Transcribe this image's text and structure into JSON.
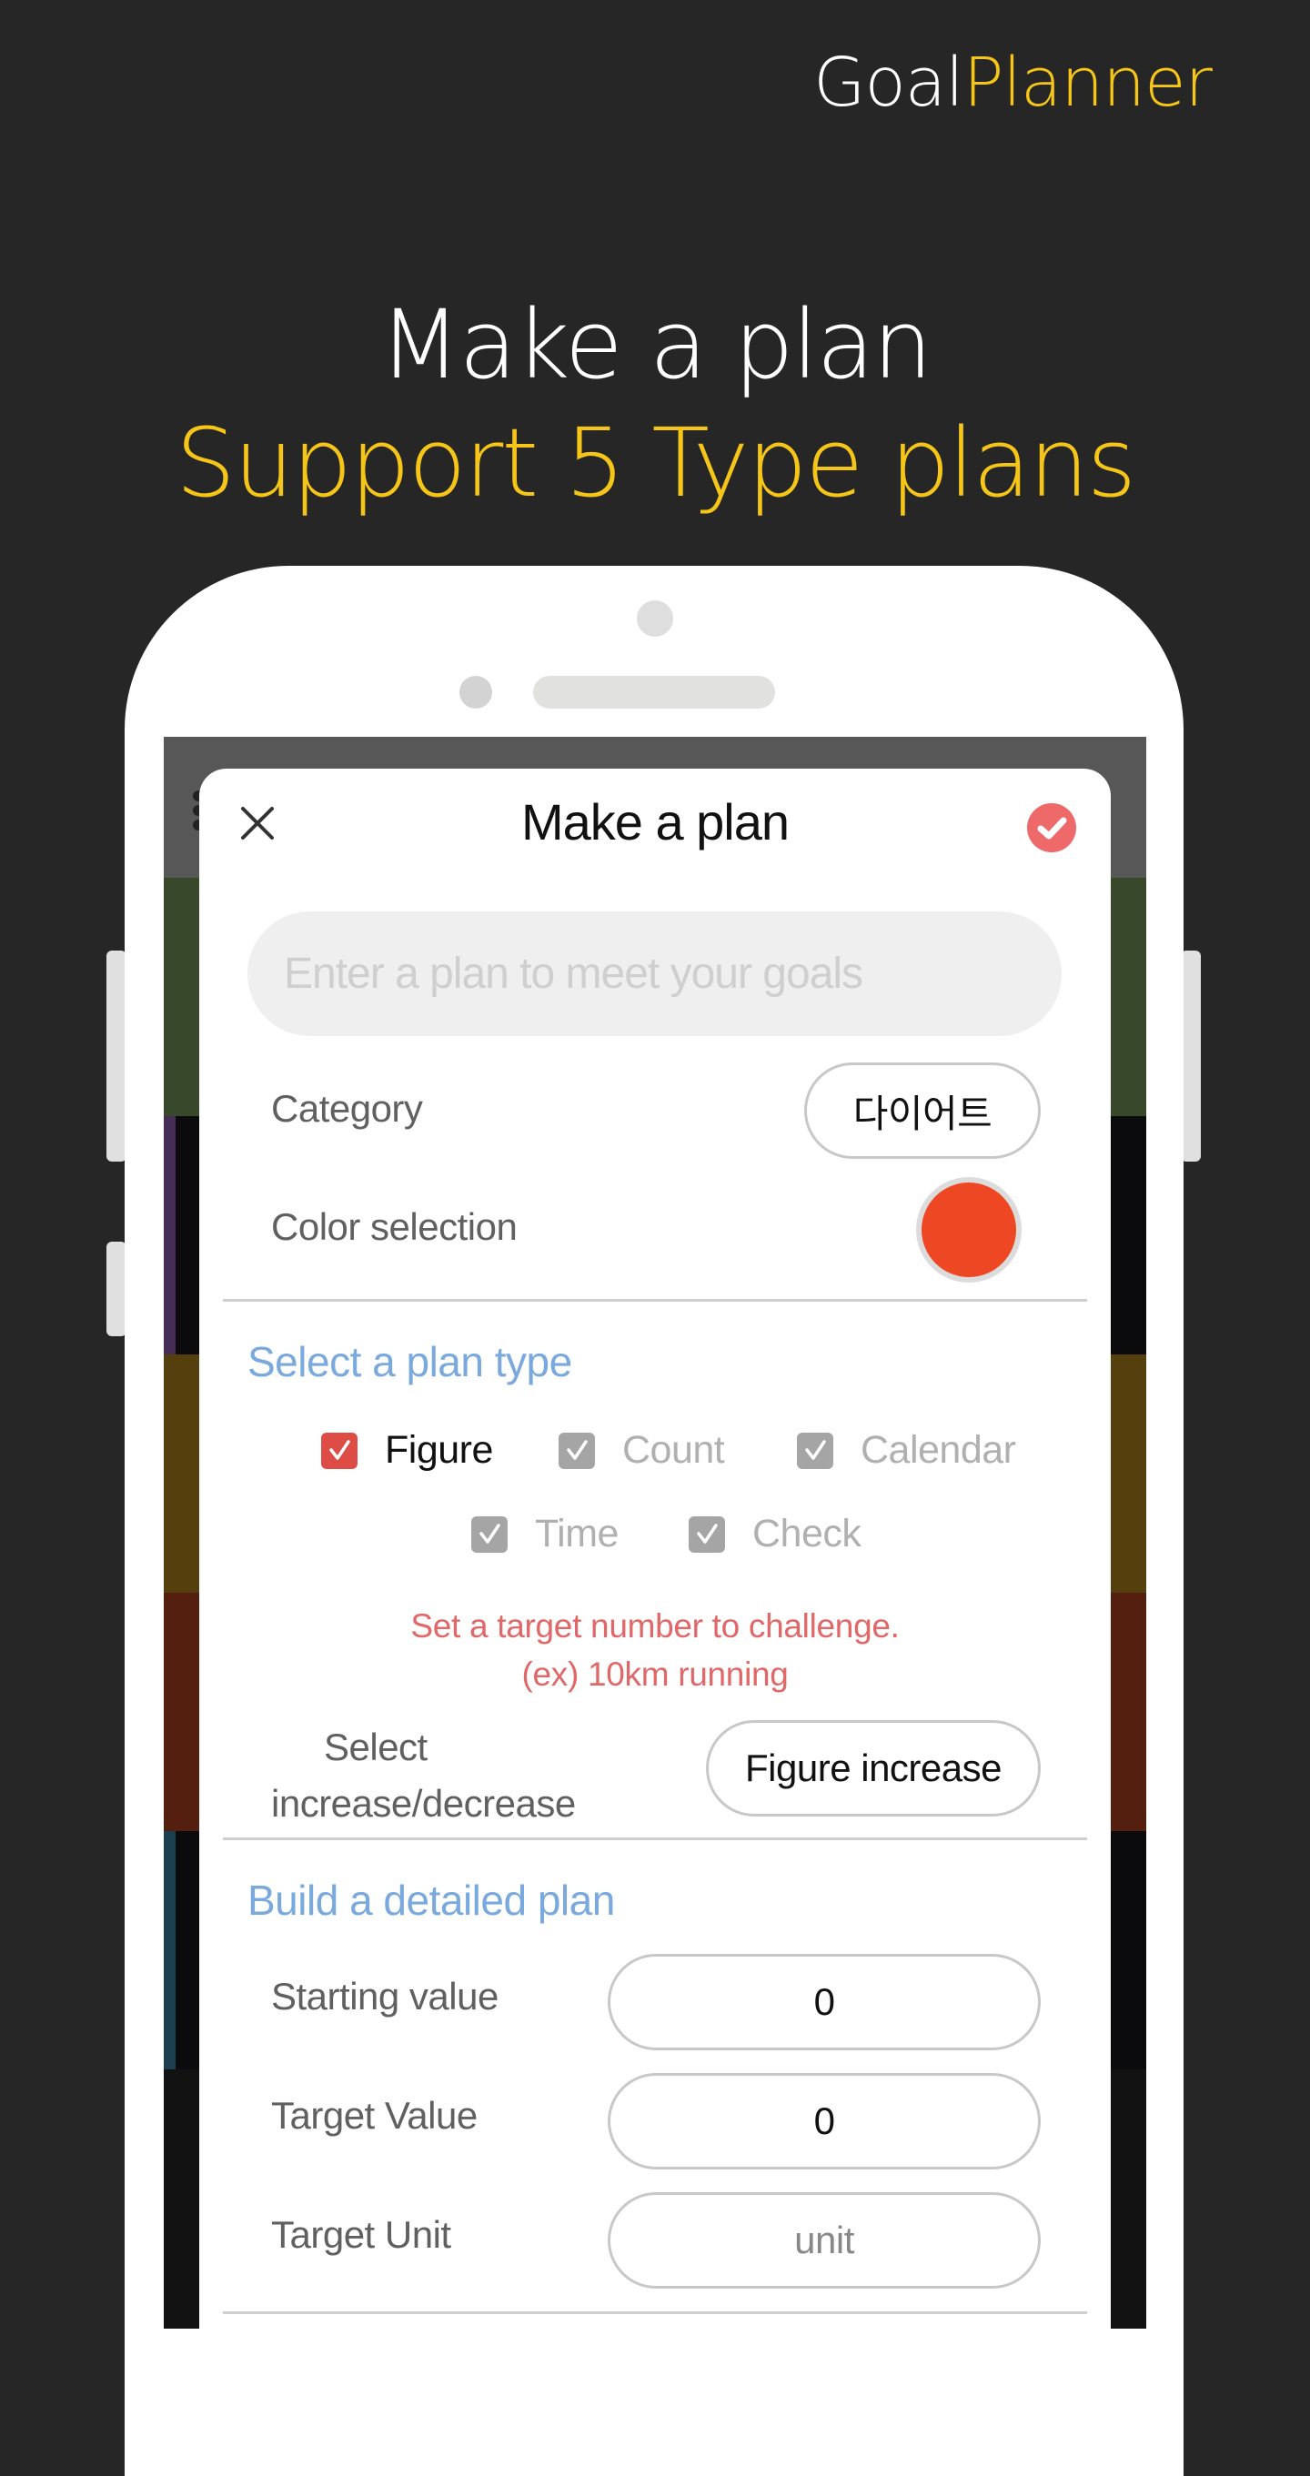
{
  "brand": {
    "part1": "Goal",
    "part2": "Planner"
  },
  "hero": {
    "line1": "Make a plan",
    "line2": "Support 5 Type plans"
  },
  "colors": {
    "background": "#262626",
    "accent_yellow": "#f5c518",
    "confirm_red": "#ee6a6a",
    "section_blue": "#7aa9dd",
    "hint_red": "#e06868",
    "selected_color": "#ee4723"
  },
  "dialog": {
    "title": "Make a plan",
    "close_icon": "close-icon",
    "confirm_icon": "check-circle-icon",
    "plan_input": {
      "value": "",
      "placeholder": "Enter a plan to meet your goals"
    },
    "category": {
      "label": "Category",
      "value": "다이어트"
    },
    "color_selection": {
      "label": "Color selection",
      "value": "#ee4723"
    },
    "plan_type": {
      "title": "Select a plan type",
      "options": [
        {
          "label": "Figure",
          "checked": true
        },
        {
          "label": "Count",
          "checked": false
        },
        {
          "label": "Calendar",
          "checked": false
        },
        {
          "label": "Time",
          "checked": false
        },
        {
          "label": "Check",
          "checked": false
        }
      ],
      "hint_line1": "Set a target number to challenge.",
      "hint_line2": "(ex) 10km running",
      "direction_label_line1": "Select",
      "direction_label_line2": "increase/decrease",
      "direction_value": "Figure increase"
    },
    "detail": {
      "title": "Build a detailed plan",
      "fields": [
        {
          "label": "Starting value",
          "value": "0"
        },
        {
          "label": "Target Value",
          "value": "0"
        },
        {
          "label": "Target Unit",
          "value": "",
          "placeholder": "unit"
        }
      ]
    }
  }
}
